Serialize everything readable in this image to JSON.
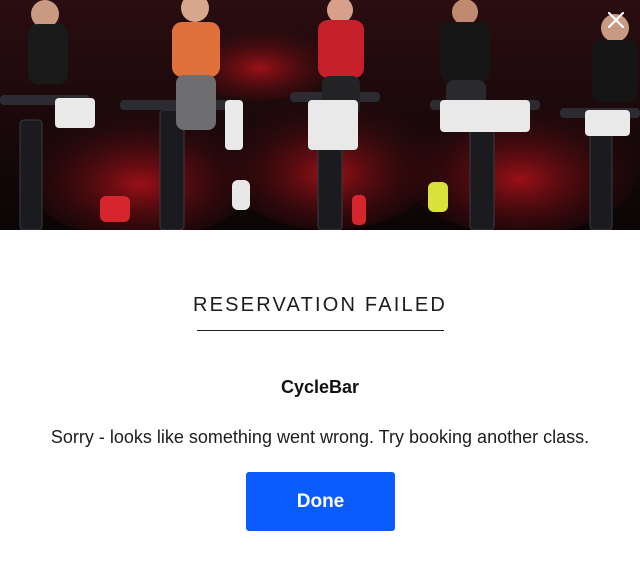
{
  "hero": {
    "image_description_icon": "spin-class-photo",
    "close_icon": "close-icon"
  },
  "dialog": {
    "title": "RESERVATION FAILED",
    "studio_name": "CycleBar",
    "message": "Sorry - looks like something went wrong. Try booking another class.",
    "done_label": "Done"
  },
  "colors": {
    "accent": "#0a5cff",
    "text": "#1c1c1c",
    "background": "#ffffff"
  }
}
